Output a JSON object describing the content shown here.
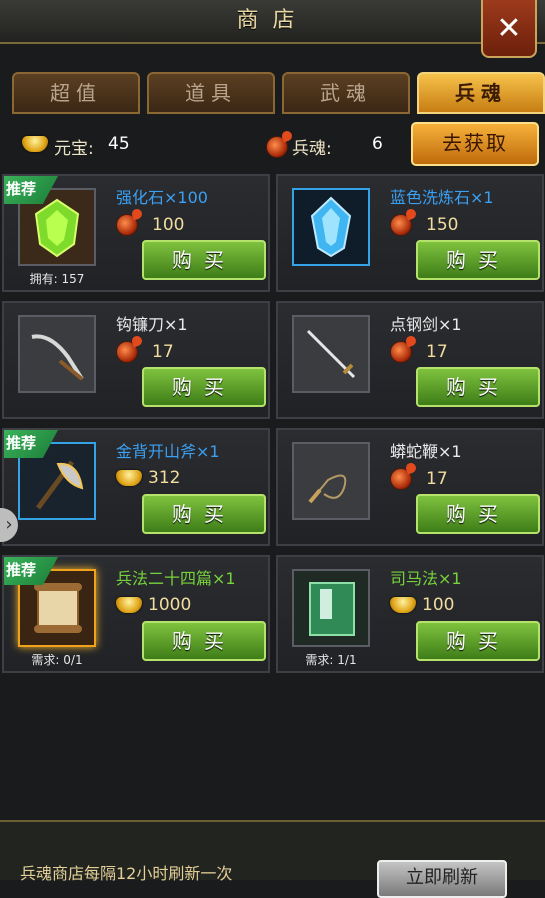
{
  "header": {
    "title": "商店",
    "close_icon": "close-icon"
  },
  "tabs": [
    {
      "label": "超值",
      "active": false
    },
    {
      "label": "道具",
      "active": false
    },
    {
      "label": "武魂",
      "active": false
    },
    {
      "label": "兵魂",
      "active": true
    }
  ],
  "currency": {
    "yuanbao_label": "元宝:",
    "yuanbao_value": "45",
    "soul_label": "兵魂:",
    "soul_value": "6",
    "get_button": "去获取"
  },
  "items": [
    {
      "name": "强化石×100",
      "color": "blue",
      "currency": "soul",
      "price": "100",
      "tag": "推荐",
      "caption": "拥有: 157",
      "frame": "plain",
      "icon": "gem-green-icon"
    },
    {
      "name": "蓝色洗炼石×1",
      "color": "blue",
      "currency": "soul",
      "price": "150",
      "tag": "",
      "caption": "",
      "frame": "blue",
      "icon": "crystal-blue-icon"
    },
    {
      "name": "钩镰刀×1",
      "color": "white",
      "currency": "soul",
      "price": "17",
      "tag": "",
      "caption": "",
      "frame": "plain",
      "icon": "hook-sickle-icon"
    },
    {
      "name": "点钢剑×1",
      "color": "white",
      "currency": "soul",
      "price": "17",
      "tag": "",
      "caption": "",
      "frame": "plain",
      "icon": "sword-icon"
    },
    {
      "name": "金背开山斧×1",
      "color": "blue",
      "currency": "yuanbao",
      "price": "312",
      "tag": "推荐",
      "caption": "",
      "frame": "blue",
      "icon": "axe-icon"
    },
    {
      "name": "蟒蛇鞭×1",
      "color": "white",
      "currency": "soul",
      "price": "17",
      "tag": "",
      "caption": "",
      "frame": "plain",
      "icon": "whip-icon"
    },
    {
      "name": "兵法二十四篇×1",
      "color": "green",
      "currency": "yuanbao",
      "price": "1000",
      "tag": "推荐",
      "caption": "需求: 0/1",
      "frame": "gold",
      "icon": "scroll-icon"
    },
    {
      "name": "司马法×1",
      "color": "green",
      "currency": "yuanbao",
      "price": "100",
      "tag": "",
      "caption": "需求: 1/1",
      "frame": "plain",
      "icon": "book-icon"
    }
  ],
  "buy_label": "购买",
  "footer": {
    "note": "兵魂商店每隔12小时刷新一次",
    "refresh_button": "立即刷新"
  }
}
